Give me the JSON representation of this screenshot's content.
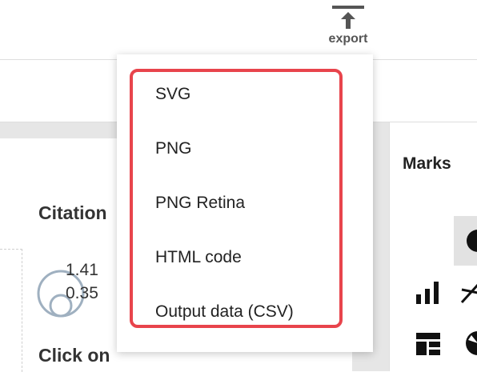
{
  "toolbar": {
    "export_label": "export",
    "export_icon": "export-icon"
  },
  "left_panel": {
    "heading": "Citation",
    "heading2": "Click on",
    "legend_values": [
      "1.41",
      "0.35"
    ]
  },
  "right_panel": {
    "marks_title": "Marks",
    "mark_icons": [
      "circle-icon",
      "bar-chart-icon",
      "line-chart-icon",
      "layout-icon",
      "pie-chart-icon"
    ]
  },
  "export_menu": {
    "items": [
      "SVG",
      "PNG",
      "PNG Retina",
      "HTML code",
      "Output data (CSV)"
    ],
    "highlight_color": "#e8444c"
  }
}
